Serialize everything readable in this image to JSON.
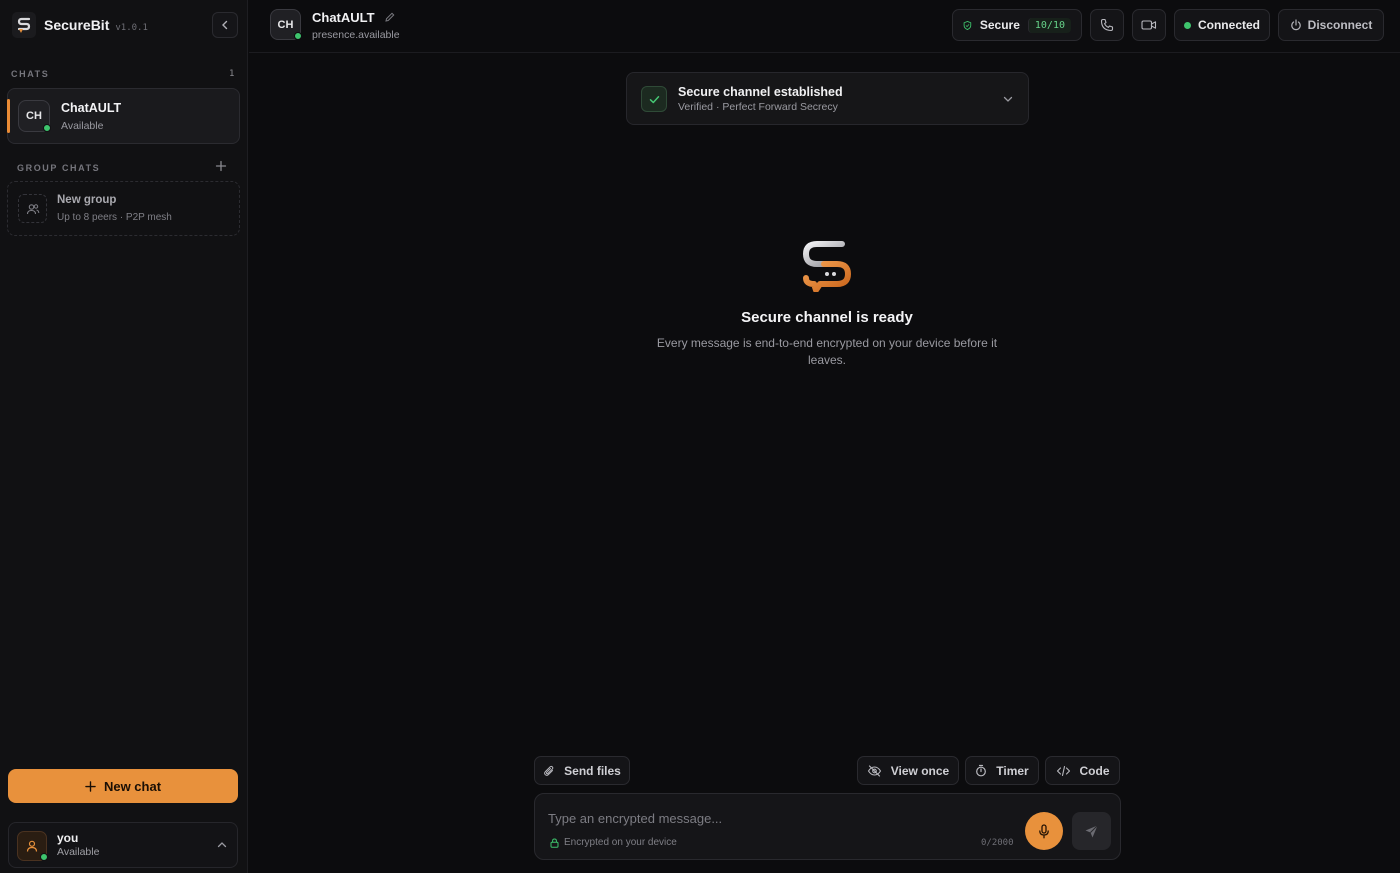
{
  "app": {
    "name": "SecureBit",
    "version": "v1.0.1"
  },
  "sidebar": {
    "chats_label": "CHATS",
    "chats_count": "1",
    "chat": {
      "initials": "CH",
      "name": "ChatAULT",
      "status": "Available"
    },
    "group_label": "GROUP CHATS",
    "new_group": {
      "title": "New group",
      "subtitle": "Up to 8 peers · P2P mesh"
    },
    "new_chat_label": "New chat",
    "user": {
      "name": "you",
      "status": "Available"
    }
  },
  "header": {
    "initials": "CH",
    "name": "ChatAULT",
    "presence": "presence.available",
    "secure_label": "Secure",
    "secure_score": "10/10",
    "connected_label": "Connected",
    "disconnect_label": "Disconnect"
  },
  "banner": {
    "title": "Secure channel established",
    "subtitle": "Verified · Perfect Forward Secrecy"
  },
  "hero": {
    "title": "Secure channel is ready",
    "subtitle": "Every message is end-to-end encrypted on your device before it leaves."
  },
  "composer": {
    "send_files": "Send files",
    "view_once": "View once",
    "timer": "Timer",
    "code": "Code",
    "placeholder": "Type an encrypted message...",
    "encrypted_note": "Encrypted on your device",
    "char_count": "0/2000"
  },
  "colors": {
    "accent": "#e8913c",
    "online": "#3ec46d",
    "background": "#0c0c0e"
  },
  "icons": [
    "logo",
    "chevron-left-icon",
    "plus-icon",
    "group-icon",
    "user-icon",
    "chevron-up-icon",
    "pencil-icon",
    "shield-icon",
    "phone-icon",
    "video-icon",
    "power-icon",
    "check-icon",
    "chevron-down-icon",
    "paperclip-icon",
    "eye-off-icon",
    "stopwatch-icon",
    "code-icon",
    "lock-icon",
    "mic-icon",
    "send-icon"
  ]
}
